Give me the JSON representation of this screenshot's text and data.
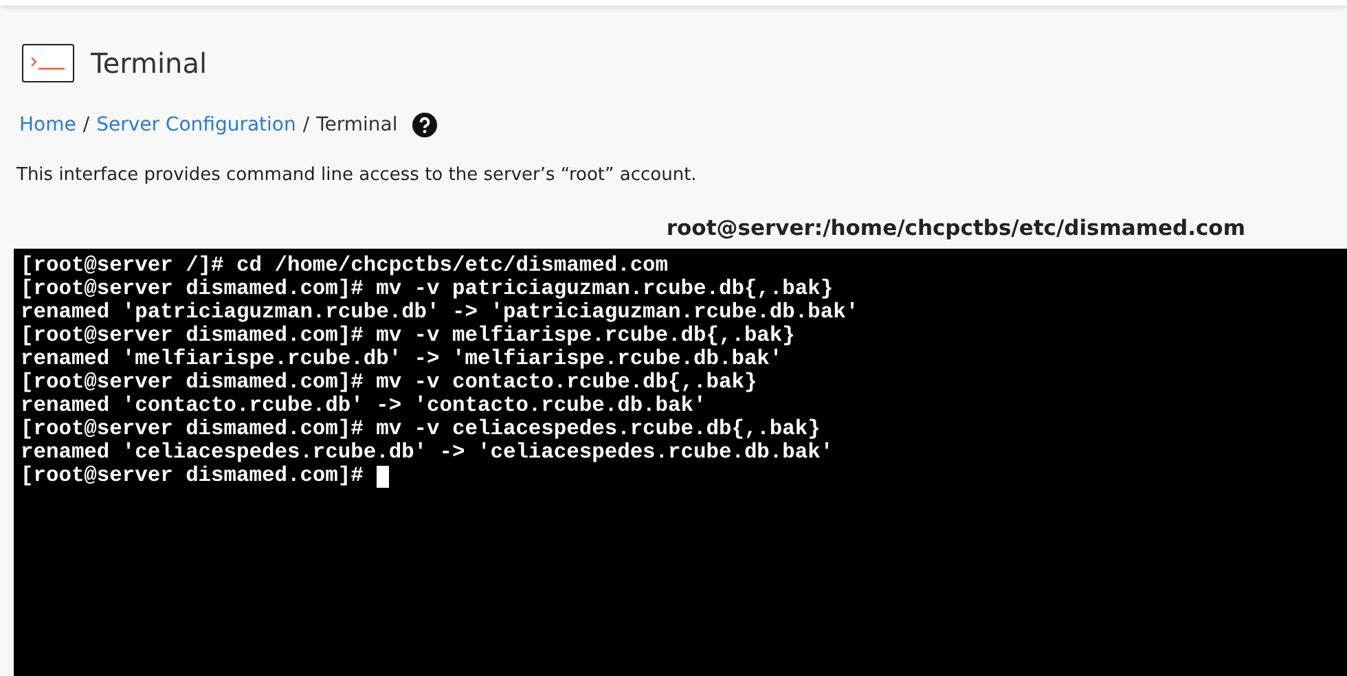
{
  "page": {
    "title": "Terminal"
  },
  "breadcrumb_separator": "/",
  "breadcrumb": [
    {
      "label": "Home",
      "kind": "link"
    },
    {
      "label": "Server Configuration",
      "kind": "link"
    },
    {
      "label": "Terminal",
      "kind": "current"
    }
  ],
  "description": "This interface provides command line access to the server’s “root” account.",
  "terminal": {
    "path": "root@server:/home/chcpctbs/etc/dismamed.com",
    "cursor": true,
    "lines": [
      "[root@server /]# cd /home/chcpctbs/etc/dismamed.com",
      "[root@server dismamed.com]# mv -v patriciaguzman.rcube.db{,.bak}",
      "renamed 'patriciaguzman.rcube.db' -> 'patriciaguzman.rcube.db.bak'",
      "[root@server dismamed.com]# mv -v melfiarispe.rcube.db{,.bak}",
      "renamed 'melfiarispe.rcube.db' -> 'melfiarispe.rcube.db.bak'",
      "[root@server dismamed.com]# mv -v contacto.rcube.db{,.bak}",
      "renamed 'contacto.rcube.db' -> 'contacto.rcube.db.bak'",
      "[root@server dismamed.com]# mv -v celiacespedes.rcube.db{,.bak}",
      "renamed 'celiacespedes.rcube.db' -> 'celiacespedes.rcube.db.bak'",
      "[root@server dismamed.com]# "
    ]
  }
}
